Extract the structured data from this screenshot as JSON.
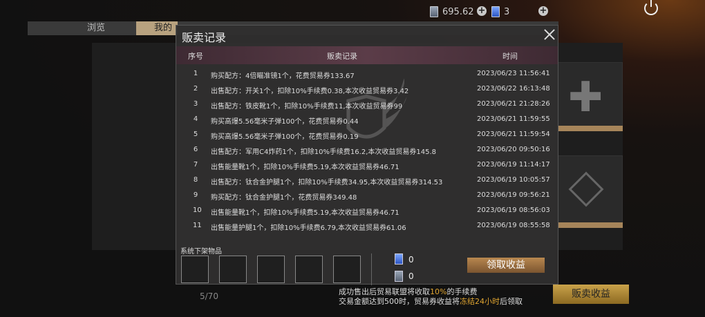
{
  "topbar": {
    "currency1": "695.62",
    "currency2": "3"
  },
  "tabs": [
    "浏览",
    "我的"
  ],
  "inventory": {
    "count": "5/70",
    "sell_revenue_label": "贩卖收益"
  },
  "dialog": {
    "title": "贩卖记录",
    "columns": {
      "index": "序号",
      "record": "贩卖记录",
      "time": "时间"
    },
    "rows": [
      {
        "n": "1",
        "record": "购买配方：4倍瞄准镜1个，花费贸易券133.67",
        "time": "2023/06/23 11:56:41"
      },
      {
        "n": "2",
        "record": "出售配方：开关1个，扣除10%手续费0.38,本次收益贸易券3.42",
        "time": "2023/06/22 16:13:48"
      },
      {
        "n": "3",
        "record": "出售配方：铁皮靴1个，扣除10%手续费11,本次收益贸易券99",
        "time": "2023/06/21 21:28:26"
      },
      {
        "n": "4",
        "record": "购买高爆5.56毫米子弹100个，花费贸易券0.44",
        "time": "2023/06/21 11:59:55"
      },
      {
        "n": "5",
        "record": "购买高爆5.56毫米子弹100个，花费贸易券0.19",
        "time": "2023/06/21 11:59:54"
      },
      {
        "n": "6",
        "record": "出售配方：军用C4炸药1个，扣除10%手续费16.2,本次收益贸易券145.8",
        "time": "2023/06/20 09:50:16"
      },
      {
        "n": "7",
        "record": "出售能量靴1个，扣除10%手续费5.19,本次收益贸易券46.71",
        "time": "2023/06/19 11:14:17"
      },
      {
        "n": "8",
        "record": "出售配方：钛合金护腿1个，扣除10%手续费34.95,本次收益贸易券314.53",
        "time": "2023/06/19 10:05:57"
      },
      {
        "n": "9",
        "record": "购买配方：钛合金护腿1个，花费贸易券349.48",
        "time": "2023/06/19 09:56:21"
      },
      {
        "n": "10",
        "record": "出售能量靴1个，扣除10%手续费5.19,本次收益贸易券46.71",
        "time": "2023/06/19 08:56:03"
      },
      {
        "n": "11",
        "record": "出售能量护腿1个，扣除10%手续费6.79,本次收益贸易券61.06",
        "time": "2023/06/19 08:55:58"
      }
    ],
    "shelf_label": "系统下架物品",
    "ticket_blue": "0",
    "ticket_gray": "0",
    "claim_label": "领取收益"
  },
  "notice": {
    "line1_a": "成功售出后贸易联盟将收取",
    "line1_pct": "10%",
    "line1_b": "的手续费",
    "line2_a": "交易金额达到500时，贸易券收益将",
    "line2_hl": "冻结24小时",
    "line2_b": "后领取"
  }
}
